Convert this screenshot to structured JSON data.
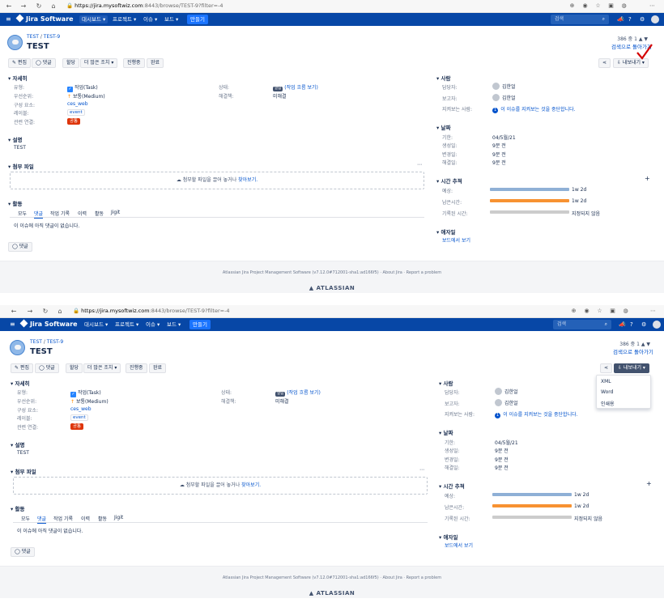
{
  "browser": {
    "url_host": "https://jira.mysoftwiz.com",
    "url_rest": ":8443/browse/TEST-9?filter=-4"
  },
  "nav": {
    "logo": "Jira Software",
    "menus": [
      "대시보드 ▾",
      "프로젝트 ▾",
      "이슈 ▾",
      "보드 ▾"
    ],
    "create": "만들기",
    "search_placeholder": "검색"
  },
  "issue": {
    "project": "TEST",
    "key": "TEST-9",
    "title": "TEST",
    "pager": "386 중 1",
    "back_link": "검색으로 돌아가기"
  },
  "toolbar": {
    "edit": "✎ 편집",
    "comment": "◯ 댓글",
    "assign": "할당",
    "more": "더 많은 조치 ▾",
    "in_progress": "진행중",
    "done": "완료",
    "export": "⇩ 내보내기 ▾"
  },
  "details": {
    "heading": "자세히",
    "type_label": "유형:",
    "type_value": "작업(Task)",
    "priority_label": "우선순위:",
    "priority_value": "보통(Medium)",
    "component_label": "구성 요소:",
    "component_value": "ces_web",
    "labels_label": "레이블:",
    "labels_value": "event",
    "related_label": "관련 연결:",
    "related_value": "공통",
    "status_label": "상태:",
    "status_lozenge": "열림",
    "status_link": "(작업 흐름 보기)",
    "resolution_label": "해결책:",
    "resolution_value": "미해결"
  },
  "description": {
    "heading": "설명",
    "text": "TEST"
  },
  "attachments": {
    "heading": "첨부 파일",
    "drop_text": "첨부할 파일을 끌어 놓거나",
    "browse": "찾아보기."
  },
  "activity": {
    "heading": "활동",
    "tabs": [
      "모두",
      "댓글",
      "작업 기록",
      "이력",
      "활동",
      "Jigit"
    ],
    "empty": "이 이슈에 아직 댓글이 없습니다.",
    "comment_button": "◯ 댓글"
  },
  "people": {
    "heading": "사람",
    "assignee_label": "담당자:",
    "assignee": "김한얼",
    "reporter_label": "보고자:",
    "reporter": "김한얼",
    "watchers_label": "지켜보는 사람:",
    "watchers_count": "1",
    "watchers_text": "이 이슈를 지켜보는 것을 중단합니다."
  },
  "dates": {
    "heading": "날짜",
    "due_label": "기한:",
    "due": "04/5월/21",
    "created_label": "생성일:",
    "created": "9분 전",
    "updated_label": "변경일:",
    "updated": "9분 전",
    "resolved_label": "해결일:",
    "resolved": "9분 전"
  },
  "time": {
    "heading": "시간 추적",
    "estimated_label": "예상:",
    "estimated": "1w 2d",
    "remaining_label": "남은시간:",
    "remaining": "1w 2d",
    "logged_label": "기록된 시간:",
    "logged": "지정되지 않음",
    "estimated_color": "#8fb0d6",
    "remaining_color": "#f79232",
    "logged_color": "#cccccc"
  },
  "dev": {
    "heading": "애자일",
    "board_link": "보드에서 보기"
  },
  "footer": {
    "links": "Atlassian Jira Project Management Software (v7.12.0#712001-sha1:ad166f5)  ·  About Jira  ·  Report a problem",
    "brand": "▲ ATLASSIAN"
  },
  "export_menu": {
    "items": [
      "XML",
      "Word",
      "인쇄용"
    ]
  }
}
